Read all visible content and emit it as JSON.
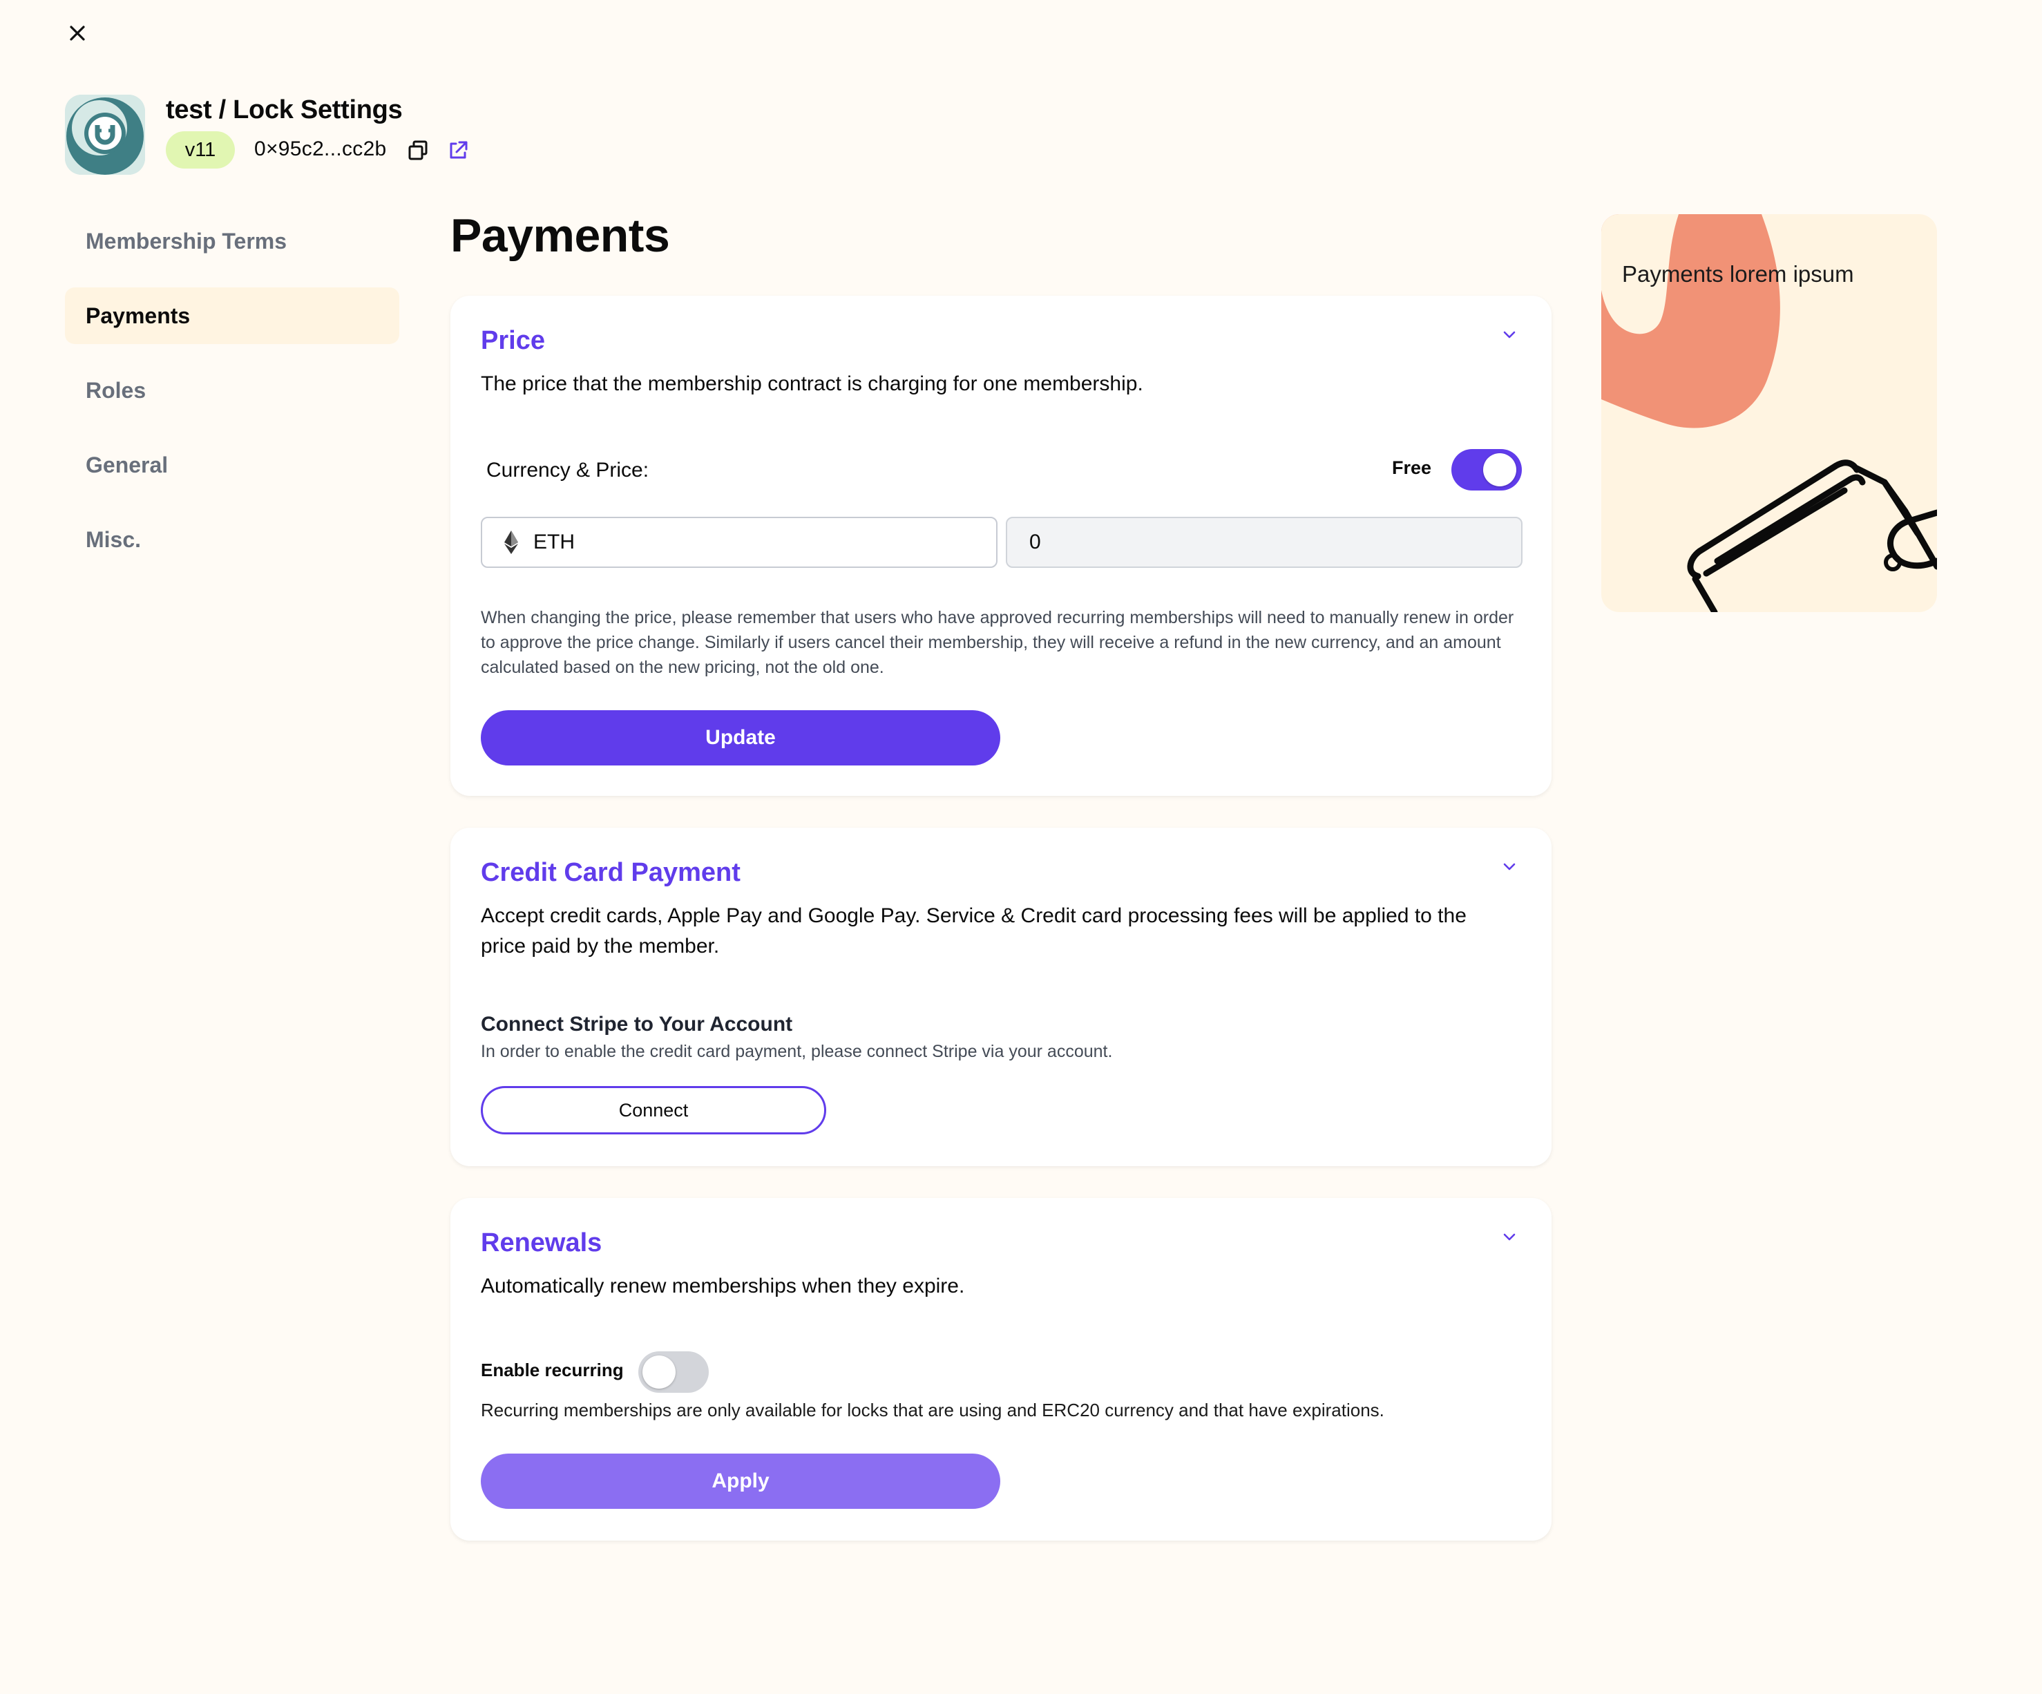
{
  "header": {
    "title": "test / Lock Settings",
    "version": "v11",
    "address": "0×95c2...cc2b"
  },
  "sidebar": {
    "items": [
      {
        "label": "Membership Terms"
      },
      {
        "label": "Payments"
      },
      {
        "label": "Roles"
      },
      {
        "label": "General"
      },
      {
        "label": "Misc."
      }
    ],
    "active": "Payments"
  },
  "main": {
    "title": "Payments",
    "price": {
      "title": "Price",
      "description": "The price that the membership contract is charging for one membership.",
      "currency_label": "Currency & Price:",
      "free_label": "Free",
      "free_enabled": true,
      "currency": "ETH",
      "price_value": "0",
      "note": "When changing the price, please remember that users who have approved recurring memberships will need to manually renew in order to approve the price change. Similarly if users cancel their membership, they will receive a refund in the new currency, and an amount calculated based on the new pricing, not the old one.",
      "button": "Update"
    },
    "credit_card": {
      "title": "Credit Card Payment",
      "description": "Accept credit cards, Apple Pay and Google Pay. Service & Credit card processing fees will be applied to the price paid by the member.",
      "connect_heading": "Connect Stripe to Your Account",
      "connect_note": "In order to enable the credit card payment, please connect Stripe via your account.",
      "button": "Connect"
    },
    "renewals": {
      "title": "Renewals",
      "description": "Automatically renew memberships when they expire.",
      "recurring_label": "Enable recurring",
      "recurring_enabled": false,
      "note": "Recurring memberships are only available for locks that are using and ERC20 currency and that have expirations.",
      "button": "Apply"
    }
  },
  "side_panel": {
    "text": "Payments lorem ipsum"
  },
  "colors": {
    "accent": "#603ceb",
    "accent_soft": "#8b6ef2",
    "background": "#fffbf5",
    "card": "#ffffff",
    "version_badge": "#e1f6b2",
    "illustration_blob": "#f19276",
    "avatar_teal": "#3f7f85"
  },
  "icons": {
    "close": "close-icon",
    "copy": "copy-icon",
    "external": "external-link-icon",
    "chevron": "chevron-down-icon",
    "eth": "ethereum-icon",
    "wallet": "wallet-illustration"
  }
}
